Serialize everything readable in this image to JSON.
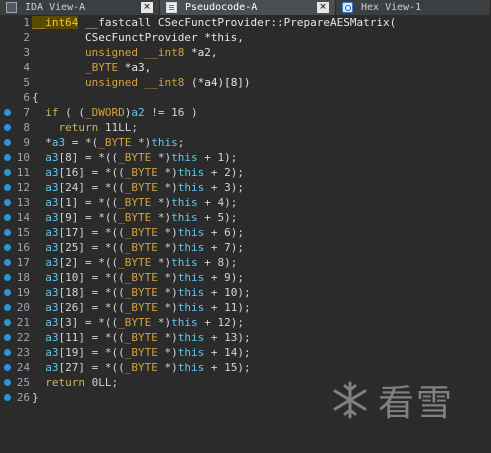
{
  "tabs": [
    {
      "label": "IDA View-A",
      "active": false,
      "icon": "ida-view-icon"
    },
    {
      "label": "Pseudocode-A",
      "active": true,
      "icon": "pseudocode-icon"
    },
    {
      "label": "Hex View-1",
      "active": false,
      "icon": "hex-view-icon"
    }
  ],
  "close_glyph": "×",
  "watermark": "看雪",
  "code_lines": [
    {
      "n": "1",
      "dot": false,
      "html": "<span class=\"ty hl\">__int64</span> <span class=\"fn\">__fastcall CSecFunctProvider::PrepareAESMatrix(</span>"
    },
    {
      "n": "2",
      "dot": false,
      "html": "        <span class=\"fn\">CSecFunctProvider *this,</span>"
    },
    {
      "n": "3",
      "dot": false,
      "html": "        <span class=\"ty\">unsigned __int8</span> <span class=\"fn\">*a2,</span>"
    },
    {
      "n": "4",
      "dot": false,
      "html": "        <span class=\"ty\">_BYTE</span> <span class=\"fn\">*a3,</span>"
    },
    {
      "n": "5",
      "dot": false,
      "html": "        <span class=\"ty\">unsigned __int8</span> <span class=\"fn\">(*a4)[8])</span>"
    },
    {
      "n": "6",
      "dot": false,
      "html": "<span class=\"op\">{</span>"
    },
    {
      "n": "7",
      "dot": true,
      "html": "  <span class=\"kw\">if</span> ( (<span class=\"ty\">_DWORD</span>)<span class=\"var\">a2</span> != 16 )"
    },
    {
      "n": "8",
      "dot": true,
      "html": "    <span class=\"kw\">return</span> 11LL;"
    },
    {
      "n": "9",
      "dot": true,
      "html": "  *<span class=\"var\">a3</span> = *(<span class=\"ty\">_BYTE</span> *)<span class=\"var\">this</span>;"
    },
    {
      "n": "10",
      "dot": true,
      "html": "  <span class=\"var\">a3</span>[8] = *((<span class=\"ty\">_BYTE</span> *)<span class=\"var\">this</span> + 1);"
    },
    {
      "n": "11",
      "dot": true,
      "html": "  <span class=\"var\">a3</span>[16] = *((<span class=\"ty\">_BYTE</span> *)<span class=\"var\">this</span> + 2);"
    },
    {
      "n": "12",
      "dot": true,
      "html": "  <span class=\"var\">a3</span>[24] = *((<span class=\"ty\">_BYTE</span> *)<span class=\"var\">this</span> + 3);"
    },
    {
      "n": "13",
      "dot": true,
      "html": "  <span class=\"var\">a3</span>[1] = *((<span class=\"ty\">_BYTE</span> *)<span class=\"var\">this</span> + 4);"
    },
    {
      "n": "14",
      "dot": true,
      "html": "  <span class=\"var\">a3</span>[9] = *((<span class=\"ty\">_BYTE</span> *)<span class=\"var\">this</span> + 5);"
    },
    {
      "n": "15",
      "dot": true,
      "html": "  <span class=\"var\">a3</span>[17] = *((<span class=\"ty\">_BYTE</span> *)<span class=\"var\">this</span> + 6);"
    },
    {
      "n": "16",
      "dot": true,
      "html": "  <span class=\"var\">a3</span>[25] = *((<span class=\"ty\">_BYTE</span> *)<span class=\"var\">this</span> + 7);"
    },
    {
      "n": "17",
      "dot": true,
      "html": "  <span class=\"var\">a3</span>[2] = *((<span class=\"ty\">_BYTE</span> *)<span class=\"var\">this</span> + 8);"
    },
    {
      "n": "18",
      "dot": true,
      "html": "  <span class=\"var\">a3</span>[10] = *((<span class=\"ty\">_BYTE</span> *)<span class=\"var\">this</span> + 9);"
    },
    {
      "n": "19",
      "dot": true,
      "html": "  <span class=\"var\">a3</span>[18] = *((<span class=\"ty\">_BYTE</span> *)<span class=\"var\">this</span> + 10);"
    },
    {
      "n": "20",
      "dot": true,
      "html": "  <span class=\"var\">a3</span>[26] = *((<span class=\"ty\">_BYTE</span> *)<span class=\"var\">this</span> + 11);"
    },
    {
      "n": "21",
      "dot": true,
      "html": "  <span class=\"var\">a3</span>[3] = *((<span class=\"ty\">_BYTE</span> *)<span class=\"var\">this</span> + 12);"
    },
    {
      "n": "22",
      "dot": true,
      "html": "  <span class=\"var\">a3</span>[11] = *((<span class=\"ty\">_BYTE</span> *)<span class=\"var\">this</span> + 13);"
    },
    {
      "n": "23",
      "dot": true,
      "html": "  <span class=\"var\">a3</span>[19] = *((<span class=\"ty\">_BYTE</span> *)<span class=\"var\">this</span> + 14);"
    },
    {
      "n": "24",
      "dot": true,
      "html": "  <span class=\"var\">a3</span>[27] = *((<span class=\"ty\">_BYTE</span> *)<span class=\"var\">this</span> + 15);"
    },
    {
      "n": "25",
      "dot": true,
      "html": "  <span class=\"kw\">return</span> 0LL;"
    },
    {
      "n": "26",
      "dot": true,
      "html": "<span class=\"op\">}</span>"
    }
  ]
}
